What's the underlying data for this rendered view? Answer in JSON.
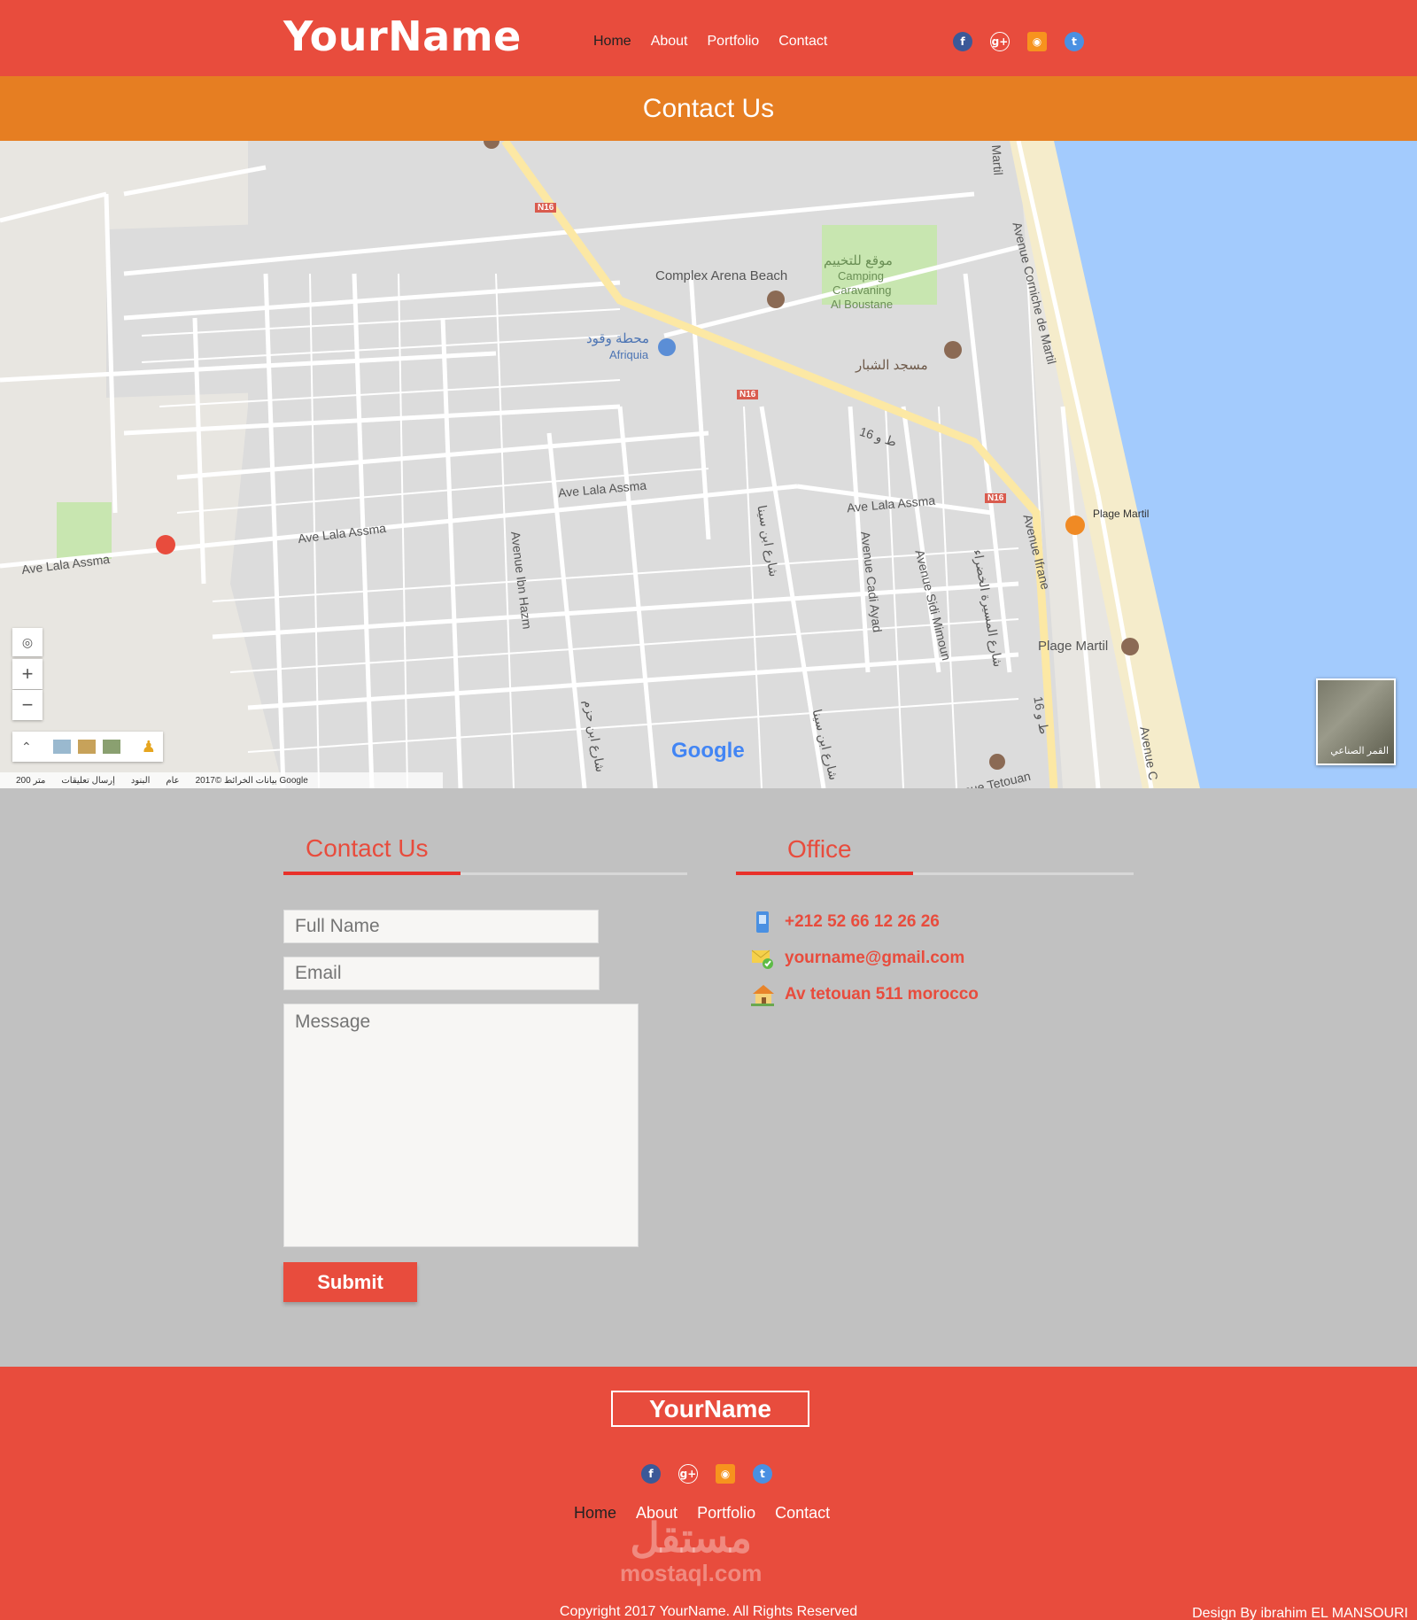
{
  "header": {
    "logo": "YourName",
    "nav": [
      "Home",
      "About",
      "Portfolio",
      "Contact"
    ]
  },
  "social_icons": [
    "facebook-icon",
    "google-plus-icon",
    "rss-icon",
    "twitter-icon"
  ],
  "colors": {
    "primary": "#e84c3d",
    "secondary": "#e67e22",
    "section_bg": "#c1c1c1"
  },
  "title_band": {
    "title": "Contact Us"
  },
  "map": {
    "labels": {
      "complex": "Complex Arena Beach",
      "camping1": "موقع للتخييم",
      "camping2": "Camping",
      "camping3": "Caravaning",
      "camping4": "Al Boustane",
      "station1": "محطة وقود",
      "station2": "Afriquia",
      "mosque": "مسجد الشبار",
      "lala1": "Ave Lala Assma",
      "lala2": "Ave Lala Assma",
      "lala3": "Ave Lala Assma",
      "lala4": "Ave Lala Assma",
      "plage": "Plage Martil",
      "plage2": "Plage Martil",
      "ibnhazm": "Avenue Ibn Hazm",
      "cadi": "Avenue Cadi Ayad",
      "sidi": "Avenue Sidi Mimoun",
      "ifrane": "Avenue Ifrane",
      "tetouan": "Avenue Tetouan",
      "corniche": "Avenue Corniche de Martil",
      "martil": "Martil",
      "n16a": "N16",
      "n16b": "N16",
      "n16c": "N16",
      "ta16a": "ط و 16",
      "ta16b": "ط و 16",
      "ibnsina1": "شارع ابن سينا",
      "ibnsina2": "شارع ابن سينا",
      "ibnhazm_ar": "شارع ابن حزم",
      "massira": "شارع المسيرة الخضراء",
      "avenue_c": "Avenue C"
    },
    "google": "Google",
    "satellite_label": "القمر الصناعي",
    "footer": [
      "بيانات الخرائط ©2017 Google",
      "عام",
      "البنود",
      "إرسال تعليقات",
      "200 متر"
    ]
  },
  "contact_form": {
    "title": "Contact Us",
    "full_name_placeholder": "Full Name",
    "email_placeholder": "Email",
    "message_placeholder": "Message",
    "submit_label": "Submit"
  },
  "office": {
    "title": "Office",
    "phone": "+212 52 66 12  26 26",
    "email": "yourname@gmail.com",
    "address": "Av tetouan 511 morocco"
  },
  "footer": {
    "logo": "YourName",
    "nav": [
      "Home",
      "About",
      "Portfolio",
      "Contact"
    ],
    "watermark1": "مستقل",
    "watermark2": "mostaql.com",
    "copyright": "Copyright 2017 YourName. All Rights Reserved",
    "design_by": "Design By ibrahim EL  MANSOURI"
  }
}
